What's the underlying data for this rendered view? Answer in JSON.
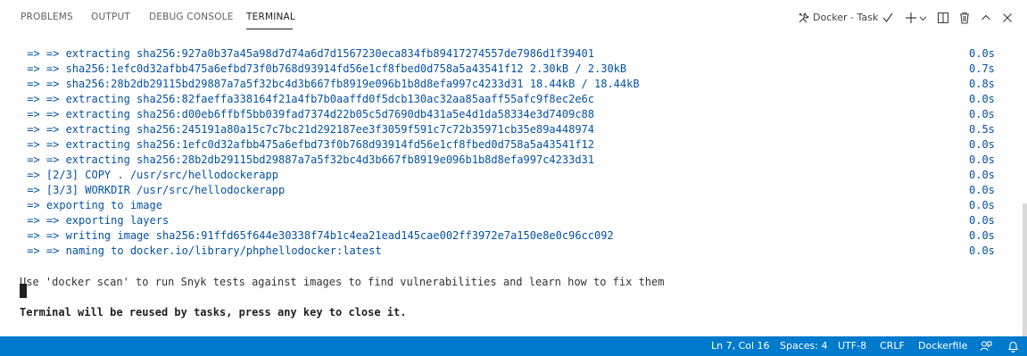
{
  "panel": {
    "tabs": [
      "PROBLEMS",
      "OUTPUT",
      "DEBUG CONSOLE",
      "TERMINAL"
    ],
    "active_tab": "TERMINAL",
    "task_label": "Docker - Task"
  },
  "terminal": {
    "lines": [
      {
        "text": " => => extracting sha256:927a0b37a45a98d7d74a6d7d1567230eca834fb89417274557de7986d1f39401",
        "time": "0.0s"
      },
      {
        "text": " => => sha256:1efc0d32afbb475a6efbd73f0b768d93914fd56e1cf8fbed0d758a5a43541f12 2.30kB / 2.30kB",
        "time": "0.7s"
      },
      {
        "text": " => => sha256:28b2db29115bd29887a7a5f32bc4d3b667fb8919e096b1b8d8efa997c4233d31 18.44kB / 18.44kB",
        "time": "0.8s"
      },
      {
        "text": " => => extracting sha256:82faeffa338164f21a4fb7b0aaffd0f5dcb130ac32aa85aaff55afc9f8ec2e6c",
        "time": "0.0s"
      },
      {
        "text": " => => extracting sha256:d00eb6ffbf5bb039fad7374d22b05c5d7690db431a5e4d1da58334e3d7409c88",
        "time": "0.0s"
      },
      {
        "text": " => => extracting sha256:245191a80a15c7c7bc21d292187ee3f3059f591c7c72b35971cb35e89a448974",
        "time": "0.5s"
      },
      {
        "text": " => => extracting sha256:1efc0d32afbb475a6efbd73f0b768d93914fd56e1cf8fbed0d758a5a43541f12",
        "time": "0.0s"
      },
      {
        "text": " => => extracting sha256:28b2db29115bd29887a7a5f32bc4d3b667fb8919e096b1b8d8efa997c4233d31",
        "time": "0.0s"
      },
      {
        "text": " => [2/3] COPY . /usr/src/hellodockerapp",
        "time": "0.0s"
      },
      {
        "text": " => [3/3] WORKDIR /usr/src/hellodockerapp",
        "time": "0.0s"
      },
      {
        "text": " => exporting to image",
        "time": "0.0s"
      },
      {
        "text": " => => exporting layers",
        "time": "0.0s"
      },
      {
        "text": " => => writing image sha256:91ffd65f644e30338f74b1c4ea21ead145cae002ff3972e7a150e8e0c96cc092",
        "time": "0.0s"
      },
      {
        "text": " => => naming to docker.io/library/phphellodocker:latest",
        "time": "0.0s"
      }
    ],
    "scan_message": "Use 'docker scan' to run Snyk tests against images to find vulnerabilities and learn how to fix them",
    "reuse_message": "Terminal will be reused by tasks, press any key to close it."
  },
  "statusbar": {
    "position": "Ln 7, Col 16",
    "spaces": "Spaces: 4",
    "encoding": "UTF-8",
    "eol": "CRLF",
    "language": "Dockerfile",
    "background_color": "#007acc"
  },
  "colors": {
    "terminal_output": "#0451a5",
    "terminal_text": "#333333",
    "accent": "#007acc"
  },
  "icons": [
    "tools-icon",
    "check-icon",
    "plus-icon",
    "chevron-down-icon",
    "split-icon",
    "trash-icon",
    "chevron-up-icon",
    "close-icon",
    "feedback-icon",
    "bell-icon"
  ]
}
